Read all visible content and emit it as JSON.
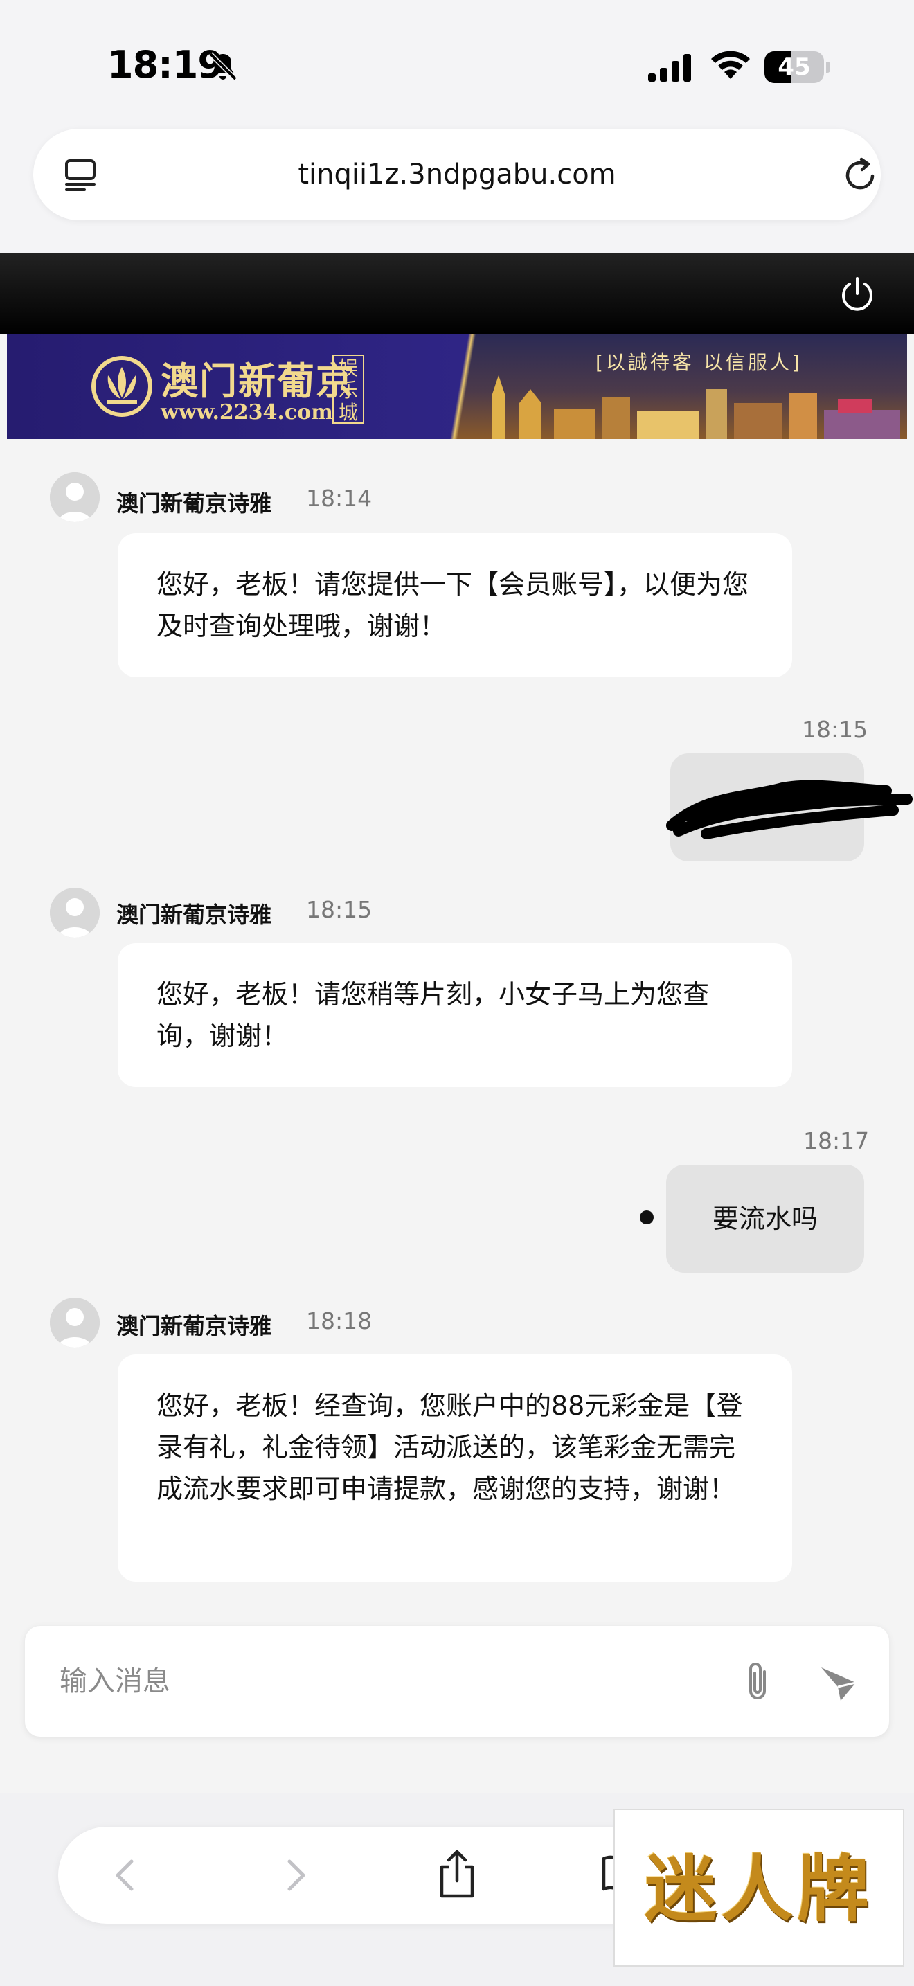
{
  "status_bar": {
    "time": "18:19",
    "battery": "45",
    "battery_level": 0.45
  },
  "browser": {
    "url": "tinqii1z.3ndpgabu.com"
  },
  "banner": {
    "title": "澳门新葡京",
    "url": "www.2234.com",
    "sub": "娱乐城",
    "slogan": "[以誠待客 以信服人]"
  },
  "messages": [
    {
      "sender": "agent",
      "name": "澳门新葡京诗雅",
      "time": "18:14",
      "text": "您好，老板！请您提供一下【会员账号】，以便为您及时查询处理哦，谢谢！"
    },
    {
      "sender": "user",
      "time": "18:15",
      "text": ""
    },
    {
      "sender": "agent",
      "name": "澳门新葡京诗雅",
      "time": "18:15",
      "text": "您好，老板！请您稍等片刻，小女子马上为您查询，谢谢！"
    },
    {
      "sender": "user",
      "time": "18:17",
      "text": "要流水吗"
    },
    {
      "sender": "agent",
      "name": "澳门新葡京诗雅",
      "time": "18:18",
      "text": "您好，老板！经查询，您账户中的88元彩金是【登录有礼，礼金待领】活动派送的，该笔彩金无需完成流水要求即可申请提款，感谢您的支持，谢谢！"
    }
  ],
  "input": {
    "placeholder": "输入消息",
    "value": ""
  },
  "watermark": {
    "text": "迷人牌"
  },
  "icons": [
    "bell-slash-icon",
    "signal-icon",
    "wifi-icon",
    "battery-icon",
    "tabs-icon",
    "reload-icon",
    "power-icon",
    "avatar-icon",
    "attach-icon",
    "send-icon",
    "back-icon",
    "forward-icon",
    "share-icon",
    "bookmarks-icon"
  ]
}
